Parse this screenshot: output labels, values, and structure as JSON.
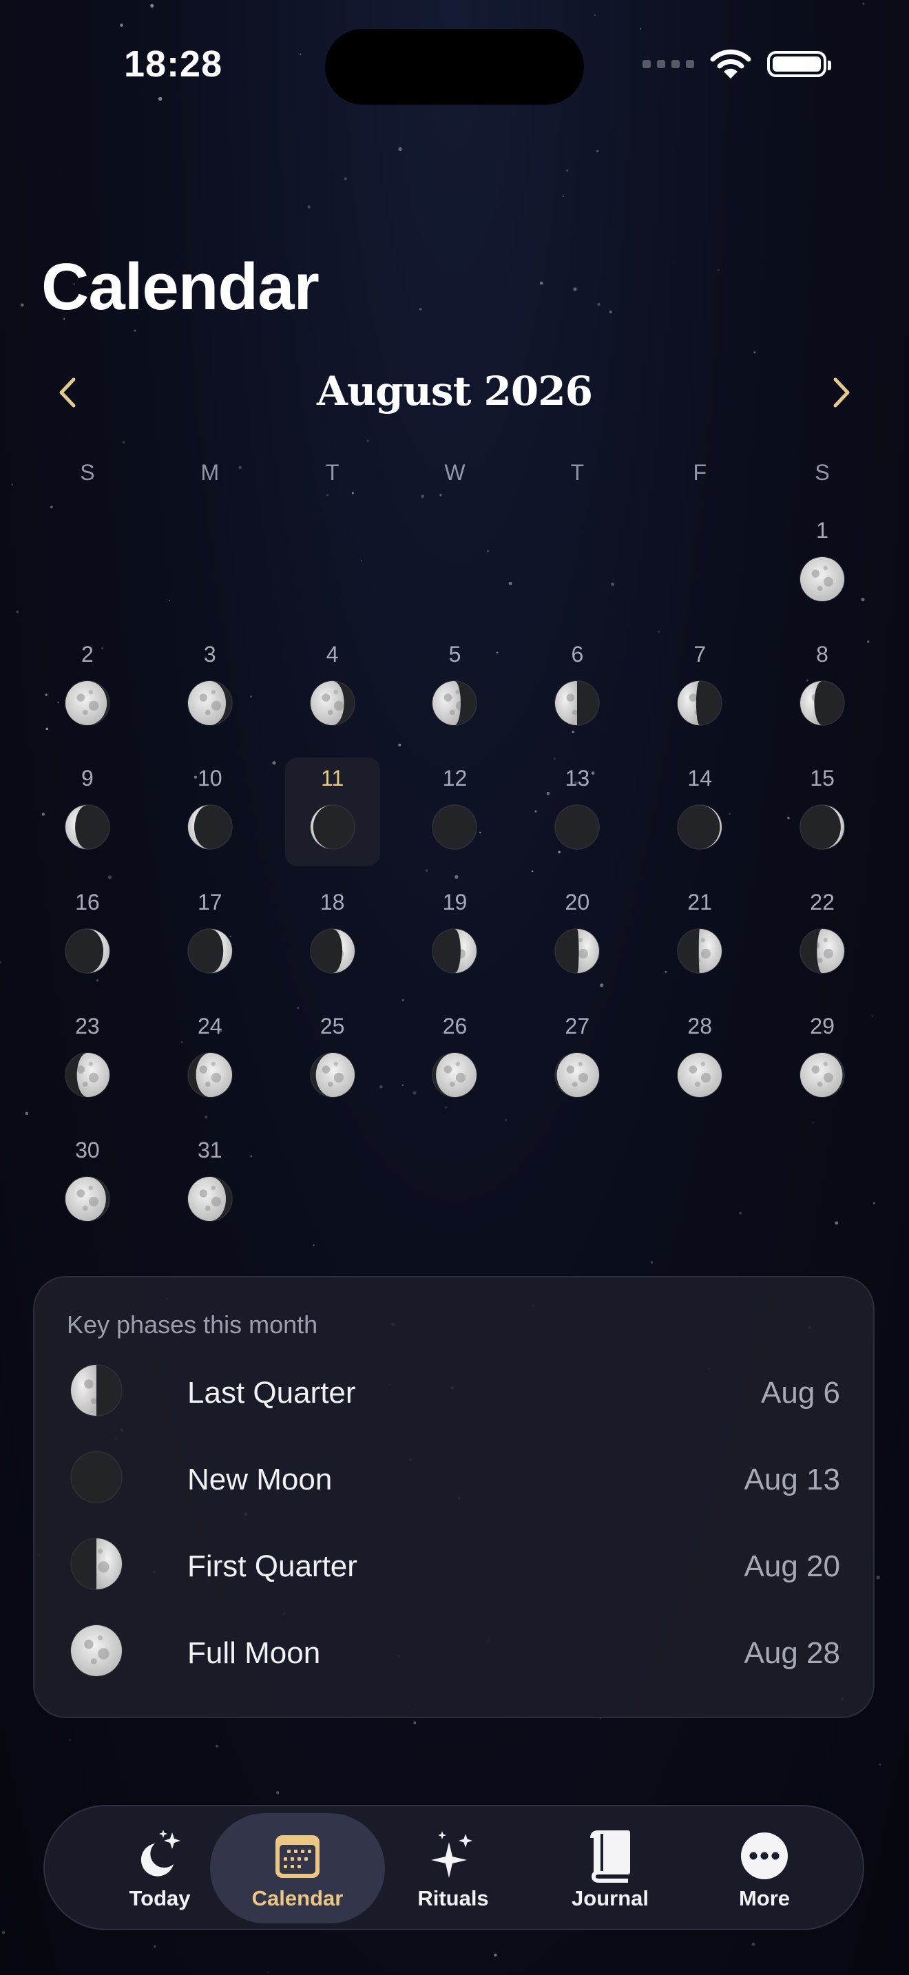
{
  "status_bar": {
    "time": "18:28"
  },
  "page_title": "Calendar",
  "month": "August 2026",
  "weekdays": [
    "S",
    "M",
    "T",
    "W",
    "T",
    "F",
    "S"
  ],
  "today": 11,
  "days": [
    {
      "day": 1,
      "phase": 0.5
    },
    {
      "day": 2,
      "phase": 0.53
    },
    {
      "day": 3,
      "phase": 0.57
    },
    {
      "day": 4,
      "phase": 0.62
    },
    {
      "day": 5,
      "phase": 0.68
    },
    {
      "day": 6,
      "phase": 0.75
    },
    {
      "day": 7,
      "phase": 0.79
    },
    {
      "day": 8,
      "phase": 0.84
    },
    {
      "day": 9,
      "phase": 0.89
    },
    {
      "day": 10,
      "phase": 0.93
    },
    {
      "day": 11,
      "phase": 0.97
    },
    {
      "day": 12,
      "phase": 0.99
    },
    {
      "day": 13,
      "phase": 0.0
    },
    {
      "day": 14,
      "phase": 0.02
    },
    {
      "day": 15,
      "phase": 0.04
    },
    {
      "day": 16,
      "phase": 0.07
    },
    {
      "day": 17,
      "phase": 0.1
    },
    {
      "day": 18,
      "phase": 0.14
    },
    {
      "day": 19,
      "phase": 0.18
    },
    {
      "day": 20,
      "phase": 0.23
    },
    {
      "day": 21,
      "phase": 0.26
    },
    {
      "day": 22,
      "phase": 0.31
    },
    {
      "day": 23,
      "phase": 0.37
    },
    {
      "day": 24,
      "phase": 0.41
    },
    {
      "day": 25,
      "phase": 0.44
    },
    {
      "day": 26,
      "phase": 0.46
    },
    {
      "day": 27,
      "phase": 0.48
    },
    {
      "day": 28,
      "phase": 0.5
    },
    {
      "day": 29,
      "phase": 0.52
    },
    {
      "day": 30,
      "phase": 0.54
    },
    {
      "day": 31,
      "phase": 0.57
    }
  ],
  "key_phases": {
    "title": "Key phases this month",
    "items": [
      {
        "name": "Last Quarter",
        "date": "Aug 6",
        "phase": 0.75
      },
      {
        "name": "New Moon",
        "date": "Aug 13",
        "phase": 0.0
      },
      {
        "name": "First Quarter",
        "date": "Aug 20",
        "phase": 0.25
      },
      {
        "name": "Full Moon",
        "date": "Aug 28",
        "phase": 0.5
      }
    ]
  },
  "tabs": [
    {
      "label": "Today",
      "icon": "moon-stars-icon"
    },
    {
      "label": "Calendar",
      "icon": "calendar-icon",
      "active": true
    },
    {
      "label": "Rituals",
      "icon": "sparkles-icon"
    },
    {
      "label": "Journal",
      "icon": "book-icon"
    },
    {
      "label": "More",
      "icon": "more-icon"
    }
  ],
  "colors": {
    "accent": "#e8c97e",
    "background": "#0b0e1d",
    "card": "#1d1e2a"
  }
}
